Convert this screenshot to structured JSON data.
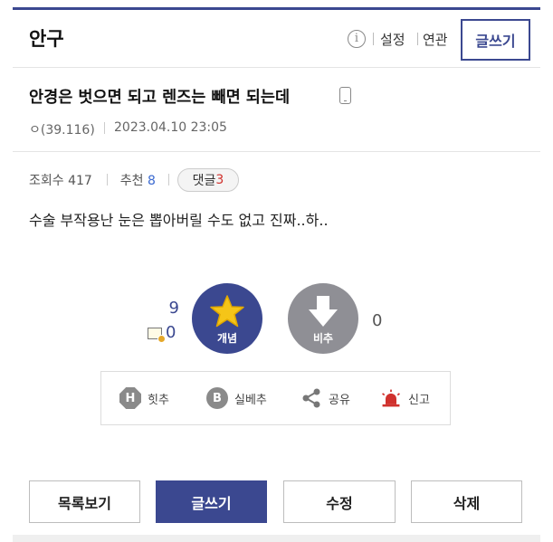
{
  "header": {
    "gallery_title": "안구",
    "info_icon_name": "info-icon",
    "settings_label": "설정",
    "related_label": "연관",
    "write_label": "글쓰기"
  },
  "post": {
    "title": "안경은 벗으면 되고 렌즈는 빼면 되는데",
    "author": "ㅇ(39.116)",
    "date": "2023.04.10 23:05",
    "views_label": "조회수 417",
    "recommend_label": "추천",
    "recommend_count": "8",
    "comment_label": "댓글",
    "comment_count": "3",
    "body": "수술 부작용난 눈은 뽑아버릴 수도 없고 진짜..하.."
  },
  "vote": {
    "up_count": "9",
    "fixed_count": "0",
    "up_label": "개념",
    "down_label": "비추",
    "down_count": "0"
  },
  "actions": {
    "hit_label": "힛추",
    "real_best_label": "실베추",
    "share_label": "공유",
    "report_label": "신고"
  },
  "footer_buttons": {
    "list_label": "목록보기",
    "write_label": "글쓰기",
    "edit_label": "수정",
    "delete_label": "삭제"
  },
  "colors": {
    "accent": "#3b4890",
    "downvote": "#8f8f95",
    "star": "#f5c518",
    "report": "#d0312d"
  }
}
